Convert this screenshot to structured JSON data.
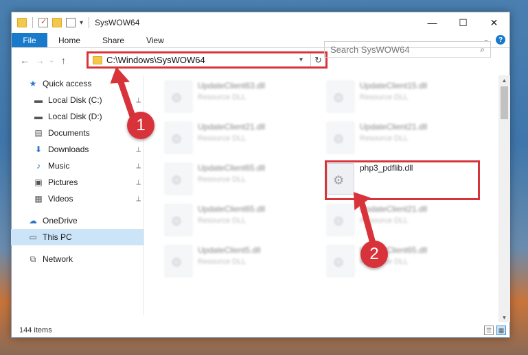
{
  "window": {
    "title": "SysWOW64",
    "controls": {
      "minimize": "—",
      "maximize": "☐",
      "close": "✕"
    }
  },
  "ribbon": {
    "tabs": [
      "File",
      "Home",
      "Share",
      "View"
    ],
    "help_label": "?"
  },
  "nav": {
    "back": "←",
    "forward": "→",
    "up": "↑",
    "address": "C:\\Windows\\SysWOW64",
    "refresh": "↻",
    "search_placeholder": "Search SysWOW64",
    "search_icon": "⌕"
  },
  "sidebar": {
    "items": [
      {
        "label": "Quick access",
        "icon": "★",
        "icon_name": "star-icon",
        "pinned": false
      },
      {
        "label": "Local Disk (C:)",
        "icon": "▬",
        "icon_name": "drive-icon",
        "pinned": true
      },
      {
        "label": "Local Disk (D:)",
        "icon": "▬",
        "icon_name": "drive-icon",
        "pinned": true
      },
      {
        "label": "Documents",
        "icon": "▤",
        "icon_name": "documents-icon",
        "pinned": true
      },
      {
        "label": "Downloads",
        "icon": "⬇",
        "icon_name": "downloads-icon",
        "pinned": true
      },
      {
        "label": "Music",
        "icon": "♪",
        "icon_name": "music-icon",
        "pinned": true
      },
      {
        "label": "Pictures",
        "icon": "▣",
        "icon_name": "pictures-icon",
        "pinned": true
      },
      {
        "label": "Videos",
        "icon": "▦",
        "icon_name": "videos-icon",
        "pinned": true
      },
      {
        "label": "OneDrive",
        "icon": "☁",
        "icon_name": "onedrive-icon",
        "pinned": false
      },
      {
        "label": "This PC",
        "icon": "▭",
        "icon_name": "computer-icon",
        "pinned": false
      },
      {
        "label": "Network",
        "icon": "⧉",
        "icon_name": "network-icon",
        "pinned": false
      }
    ],
    "pin_glyph": "📌"
  },
  "files": [
    {
      "name": "UpdateClient63.dll",
      "type": "Resource DLL"
    },
    {
      "name": "UpdateClient15.dll",
      "type": "Resource DLL"
    },
    {
      "name": "UpdateClient21.dll",
      "type": "Resource DLL"
    },
    {
      "name": "UpdateClient21.dll",
      "type": "Resource DLL"
    },
    {
      "name": "UpdateClient65.dll",
      "type": "Resource DLL"
    },
    {
      "name": "php3_pdflib.dll",
      "type": ""
    },
    {
      "name": "UpdateClient65.dll",
      "type": "Resource DLL"
    },
    {
      "name": "UpdateClient21.dll",
      "type": "Resource DLL"
    },
    {
      "name": "UpdateClient5.dll",
      "type": "Resource DLL"
    },
    {
      "name": "UpdateClient65.dll",
      "type": "Resource DLL"
    }
  ],
  "status": {
    "item_count": "144 items"
  },
  "annotations": {
    "step1": "1",
    "step2": "2",
    "color": "#d8333a"
  }
}
